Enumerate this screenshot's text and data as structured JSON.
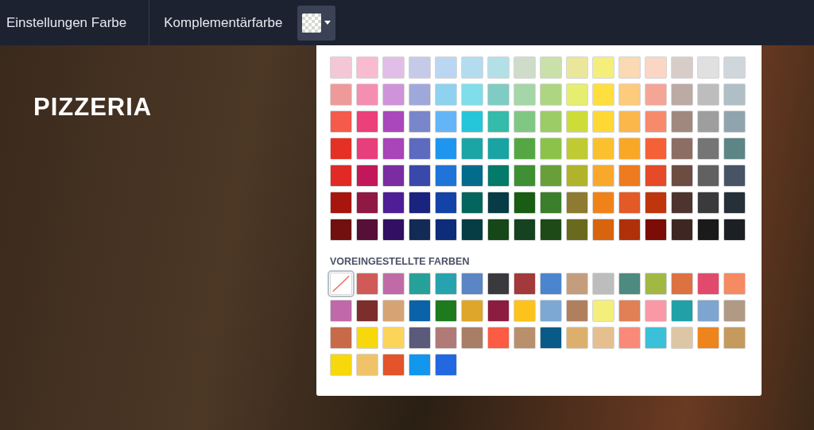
{
  "toolbar": {
    "tabs": [
      {
        "label": "Einstellungen Farbe"
      },
      {
        "label": "Komplementärfarbe"
      }
    ]
  },
  "photo": {
    "title": "PIZZERIA"
  },
  "palette": {
    "swatches": [
      {
        "color": "#f4c7d7",
        "selected": false
      },
      {
        "color": "#f8bbd0",
        "selected": false
      },
      {
        "color": "#e1bee7",
        "selected": false
      },
      {
        "color": "#c5cae9",
        "selected": false
      },
      {
        "color": "#bbd6f3",
        "selected": false
      },
      {
        "color": "#b3dcef",
        "selected": false
      },
      {
        "color": "#b2e0e6",
        "selected": false
      },
      {
        "color": "#cfdcc9",
        "selected": false
      },
      {
        "color": "#c9e0a8",
        "selected": false
      },
      {
        "color": "#eae79c",
        "selected": false
      },
      {
        "color": "#f4ef7c",
        "selected": false
      },
      {
        "color": "#fad9b3",
        "selected": false
      },
      {
        "color": "#fcd6c4",
        "selected": false
      },
      {
        "color": "#d7ccc8",
        "selected": false
      },
      {
        "color": "#e0e0e0",
        "selected": false
      },
      {
        "color": "#cfd6dc",
        "selected": false
      },
      {
        "color": "#ef9a9a",
        "selected": false
      },
      {
        "color": "#f48fb1",
        "selected": false
      },
      {
        "color": "#ce93d8",
        "selected": false
      },
      {
        "color": "#9fa8da",
        "selected": false
      },
      {
        "color": "#8fd2ef",
        "selected": false
      },
      {
        "color": "#80deea",
        "selected": false
      },
      {
        "color": "#80cbc4",
        "selected": false
      },
      {
        "color": "#a5d6a7",
        "selected": false
      },
      {
        "color": "#aed581",
        "selected": false
      },
      {
        "color": "#e6ee70",
        "selected": false
      },
      {
        "color": "#ffdf40",
        "selected": false
      },
      {
        "color": "#fccb7c",
        "selected": false
      },
      {
        "color": "#f5a596",
        "selected": false
      },
      {
        "color": "#bcaaa4",
        "selected": false
      },
      {
        "color": "#bdbdbd",
        "selected": false
      },
      {
        "color": "#b0bec5",
        "selected": false
      },
      {
        "color": "#f55a4a",
        "selected": false
      },
      {
        "color": "#ec407a",
        "selected": false
      },
      {
        "color": "#ab47bc",
        "selected": false
      },
      {
        "color": "#7986cb",
        "selected": false
      },
      {
        "color": "#64b5f6",
        "selected": false
      },
      {
        "color": "#26c6da",
        "selected": false
      },
      {
        "color": "#34bba9",
        "selected": false
      },
      {
        "color": "#81c784",
        "selected": false
      },
      {
        "color": "#9ccc65",
        "selected": false
      },
      {
        "color": "#cddc39",
        "selected": false
      },
      {
        "color": "#ffd835",
        "selected": false
      },
      {
        "color": "#fbb74c",
        "selected": false
      },
      {
        "color": "#f88a6c",
        "selected": false
      },
      {
        "color": "#a1887f",
        "selected": false
      },
      {
        "color": "#9e9e9e",
        "selected": false
      },
      {
        "color": "#90a4ae",
        "selected": false
      },
      {
        "color": "#e53025",
        "selected": false
      },
      {
        "color": "#e83e7c",
        "selected": false
      },
      {
        "color": "#a944b9",
        "selected": false
      },
      {
        "color": "#5c6bc0",
        "selected": false
      },
      {
        "color": "#1e96f0",
        "selected": false
      },
      {
        "color": "#1ca5a5",
        "selected": false
      },
      {
        "color": "#1aa3a3",
        "selected": false
      },
      {
        "color": "#55a744",
        "selected": false
      },
      {
        "color": "#8bc34a",
        "selected": false
      },
      {
        "color": "#c0ca33",
        "selected": false
      },
      {
        "color": "#fbc02d",
        "selected": false
      },
      {
        "color": "#f9a726",
        "selected": false
      },
      {
        "color": "#f66036",
        "selected": false
      },
      {
        "color": "#8d6e63",
        "selected": false
      },
      {
        "color": "#757575",
        "selected": false
      },
      {
        "color": "#5d8585",
        "selected": false
      },
      {
        "color": "#e12a25",
        "selected": false
      },
      {
        "color": "#c2185b",
        "selected": false
      },
      {
        "color": "#7b2ca2",
        "selected": false
      },
      {
        "color": "#3949ab",
        "selected": false
      },
      {
        "color": "#1e74d9",
        "selected": false
      },
      {
        "color": "#026c8c",
        "selected": false
      },
      {
        "color": "#037a6a",
        "selected": false
      },
      {
        "color": "#3f8f35",
        "selected": false
      },
      {
        "color": "#689f38",
        "selected": false
      },
      {
        "color": "#afb42b",
        "selected": false
      },
      {
        "color": "#f9a82b",
        "selected": false
      },
      {
        "color": "#ef7b20",
        "selected": false
      },
      {
        "color": "#e64a28",
        "selected": false
      },
      {
        "color": "#6d4c41",
        "selected": false
      },
      {
        "color": "#616161",
        "selected": false
      },
      {
        "color": "#475466",
        "selected": false
      },
      {
        "color": "#a8150e",
        "selected": false
      },
      {
        "color": "#8f1942",
        "selected": false
      },
      {
        "color": "#4f1e96",
        "selected": false
      },
      {
        "color": "#1a237e",
        "selected": false
      },
      {
        "color": "#1343a6",
        "selected": false
      },
      {
        "color": "#03655e",
        "selected": false
      },
      {
        "color": "#073b46",
        "selected": false
      },
      {
        "color": "#195c14",
        "selected": false
      },
      {
        "color": "#3b7f2c",
        "selected": false
      },
      {
        "color": "#8e7a30",
        "selected": false
      },
      {
        "color": "#ef8319",
        "selected": false
      },
      {
        "color": "#e35a26",
        "selected": false
      },
      {
        "color": "#bf360c",
        "selected": false
      },
      {
        "color": "#4e342e",
        "selected": false
      },
      {
        "color": "#3a3a3c",
        "selected": false
      },
      {
        "color": "#263038",
        "selected": false
      },
      {
        "color": "#721010",
        "selected": false
      },
      {
        "color": "#560f36",
        "selected": false
      },
      {
        "color": "#320f62",
        "selected": false
      },
      {
        "color": "#122a56",
        "selected": false
      },
      {
        "color": "#0d2c7a",
        "selected": false
      },
      {
        "color": "#063c44",
        "selected": false
      },
      {
        "color": "#154718",
        "selected": false
      },
      {
        "color": "#154220",
        "selected": false
      },
      {
        "color": "#1e4a18",
        "selected": false
      },
      {
        "color": "#6a6a1e",
        "selected": false
      },
      {
        "color": "#d9640e",
        "selected": false
      },
      {
        "color": "#b0300a",
        "selected": false
      },
      {
        "color": "#7b0c06",
        "selected": false
      },
      {
        "color": "#3e2723",
        "selected": false
      },
      {
        "color": "#1a1a1a",
        "selected": false
      },
      {
        "color": "#1c1f24",
        "selected": false
      }
    ],
    "preset_heading": "VOREINGESTELLTE FARBEN",
    "presets": [
      {
        "kind": "none",
        "selected": true
      },
      {
        "kind": "color",
        "color": "#d05a58",
        "selected": false
      },
      {
        "kind": "color",
        "color": "#c06ba6",
        "selected": false
      },
      {
        "kind": "color",
        "color": "#26a19a",
        "selected": false
      },
      {
        "kind": "color",
        "color": "#26a3ae",
        "selected": false
      },
      {
        "kind": "color",
        "color": "#5b85c4",
        "selected": false
      },
      {
        "kind": "color",
        "color": "#3a393d",
        "selected": false
      },
      {
        "kind": "color",
        "color": "#a3393a",
        "selected": false
      },
      {
        "kind": "color",
        "color": "#4b85d0",
        "selected": false
      },
      {
        "kind": "color",
        "color": "#c49e7c",
        "selected": false
      },
      {
        "kind": "color",
        "color": "#bdbdbe",
        "selected": false
      },
      {
        "kind": "color",
        "color": "#4d8a7f",
        "selected": false
      },
      {
        "kind": "color",
        "color": "#a1b843",
        "selected": false
      },
      {
        "kind": "color",
        "color": "#dc7141",
        "selected": false
      },
      {
        "kind": "color",
        "color": "#e24a6d",
        "selected": false
      },
      {
        "kind": "color",
        "color": "#f58a63",
        "selected": false
      },
      {
        "kind": "color",
        "color": "#c069aa",
        "selected": false
      },
      {
        "kind": "color",
        "color": "#7c2e2c",
        "selected": false
      },
      {
        "kind": "color",
        "color": "#d6a474",
        "selected": false
      },
      {
        "kind": "color",
        "color": "#0a62a8",
        "selected": false
      },
      {
        "kind": "color",
        "color": "#1e7a1e",
        "selected": false
      },
      {
        "kind": "color",
        "color": "#dea62a",
        "selected": false
      },
      {
        "kind": "color",
        "color": "#8c1c40",
        "selected": false
      },
      {
        "kind": "color",
        "color": "#fec21c",
        "selected": false
      },
      {
        "kind": "color",
        "color": "#7ea8d4",
        "selected": false
      },
      {
        "kind": "color",
        "color": "#b0805e",
        "selected": false
      },
      {
        "kind": "color",
        "color": "#f4ee7a",
        "selected": false
      },
      {
        "kind": "color",
        "color": "#e08054",
        "selected": false
      },
      {
        "kind": "color",
        "color": "#f998a6",
        "selected": false
      },
      {
        "kind": "color",
        "color": "#22a0a8",
        "selected": false
      },
      {
        "kind": "color",
        "color": "#7ea4d0",
        "selected": false
      },
      {
        "kind": "color",
        "color": "#b09a86",
        "selected": false
      },
      {
        "kind": "color",
        "color": "#c86a48",
        "selected": false
      },
      {
        "kind": "color",
        "color": "#f6d80c",
        "selected": false
      },
      {
        "kind": "color",
        "color": "#fcd45a",
        "selected": false
      },
      {
        "kind": "color",
        "color": "#5c5a7a",
        "selected": false
      },
      {
        "kind": "color",
        "color": "#b07a76",
        "selected": false
      },
      {
        "kind": "color",
        "color": "#a87e66",
        "selected": false
      },
      {
        "kind": "color",
        "color": "#fc5c44",
        "selected": false
      },
      {
        "kind": "color",
        "color": "#b8906c",
        "selected": false
      },
      {
        "kind": "color",
        "color": "#085a88",
        "selected": false
      },
      {
        "kind": "color",
        "color": "#dcb06c",
        "selected": false
      },
      {
        "kind": "color",
        "color": "#e6bf90",
        "selected": false
      },
      {
        "kind": "color",
        "color": "#f98a7a",
        "selected": false
      },
      {
        "kind": "color",
        "color": "#3ac0d8",
        "selected": false
      },
      {
        "kind": "color",
        "color": "#dcc6a6",
        "selected": false
      },
      {
        "kind": "color",
        "color": "#ee841c",
        "selected": false
      },
      {
        "kind": "color",
        "color": "#c49a5e",
        "selected": false
      },
      {
        "kind": "color",
        "color": "#f6d80d",
        "selected": false
      },
      {
        "kind": "color",
        "color": "#f0c368",
        "selected": false
      },
      {
        "kind": "color",
        "color": "#e4542a",
        "selected": false
      },
      {
        "kind": "color",
        "color": "#1396ee",
        "selected": false
      },
      {
        "kind": "color",
        "color": "#2268e0",
        "selected": false
      }
    ]
  }
}
